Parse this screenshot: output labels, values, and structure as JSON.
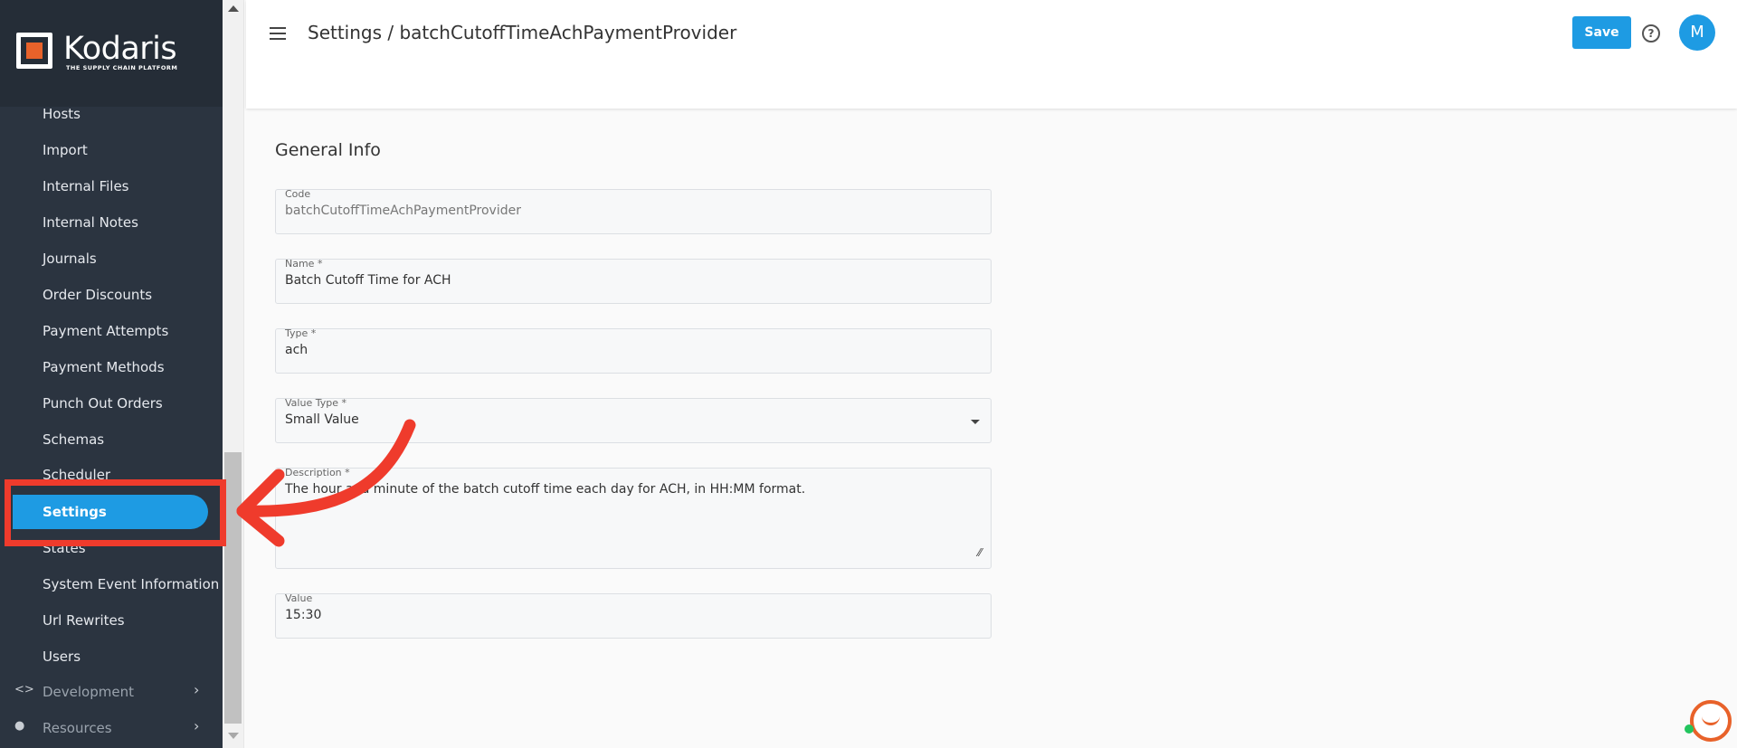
{
  "brand": {
    "name": "Kodaris",
    "tagline": "THE SUPPLY CHAIN PLATFORM",
    "accent": "#1e9be3",
    "logo_color": "#e8622a"
  },
  "sidebar": {
    "items": [
      {
        "label": "Hosts"
      },
      {
        "label": "Import"
      },
      {
        "label": "Internal Files"
      },
      {
        "label": "Internal Notes"
      },
      {
        "label": "Journals"
      },
      {
        "label": "Order Discounts"
      },
      {
        "label": "Payment Attempts"
      },
      {
        "label": "Payment Methods"
      },
      {
        "label": "Punch Out Orders"
      },
      {
        "label": "Schemas"
      },
      {
        "label": "Scheduler"
      },
      {
        "label": "Settings",
        "active": true
      },
      {
        "label": "States"
      },
      {
        "label": "System Event Information"
      },
      {
        "label": "Url Rewrites"
      },
      {
        "label": "Users"
      }
    ],
    "groups": [
      {
        "label": "Development",
        "icon": "code-icon"
      },
      {
        "label": "Resources",
        "icon": "help-circle-icon"
      }
    ]
  },
  "header": {
    "title": "Settings / batchCutoffTimeAchPaymentProvider",
    "save_label": "Save",
    "avatar_initial": "M",
    "help_glyph": "?"
  },
  "form": {
    "section_title": "General Info",
    "code": {
      "label": "Code",
      "value": "batchCutoffTimeAchPaymentProvider"
    },
    "name": {
      "label": "Name *",
      "value": "Batch Cutoff Time for ACH"
    },
    "type": {
      "label": "Type *",
      "value": "ach"
    },
    "value_type": {
      "label": "Value Type *",
      "value": "Small Value"
    },
    "description": {
      "label": "Description *",
      "value": "The hour and minute of the batch cutoff time each day for ACH, in HH:MM format."
    },
    "value": {
      "label": "Value",
      "value": "15:30"
    }
  },
  "annotation": {
    "color": "#ef3b2c"
  }
}
